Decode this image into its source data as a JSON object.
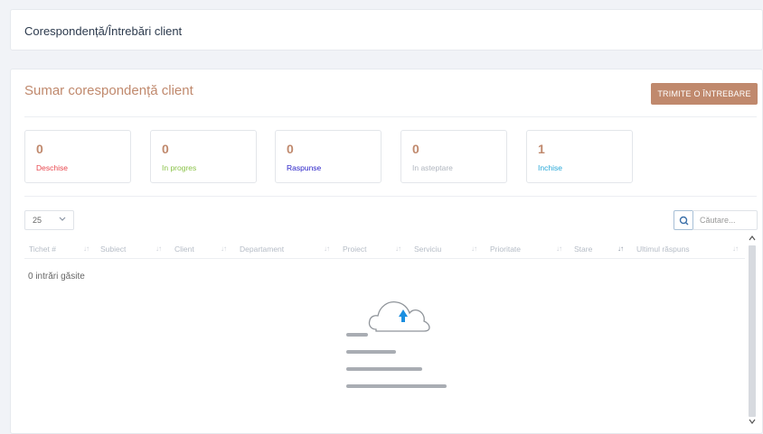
{
  "header": {
    "title": "Corespondență/Întrebări client"
  },
  "summary": {
    "title": "Sumar corespondență client",
    "ask_button": "TRIMITE O ÎNTREBARE",
    "stats": [
      {
        "count": "0",
        "label": "Deschise",
        "color": "#e8474e"
      },
      {
        "count": "0",
        "label": "In progres",
        "color": "#8bc34a"
      },
      {
        "count": "0",
        "label": "Raspunse",
        "color": "#2a22c8"
      },
      {
        "count": "0",
        "label": "In asteptare",
        "color": "#b0b6bf"
      },
      {
        "count": "1",
        "label": "Inchise",
        "color": "#28a8d8"
      }
    ],
    "count_color": "#c0896d"
  },
  "table": {
    "page_size": "25",
    "search_placeholder": "Căutare...",
    "columns": [
      "Tichet #",
      "Subiect",
      "Client",
      "Departament",
      "Proiect",
      "Serviciu",
      "Prioritate",
      "Stare",
      "Ultimul răspuns"
    ],
    "empty_message": "0 intrări găsite"
  },
  "icons": {
    "search": "search-icon",
    "dropdown": "chevron-down-icon",
    "empty": "cloud-upload-icon"
  }
}
